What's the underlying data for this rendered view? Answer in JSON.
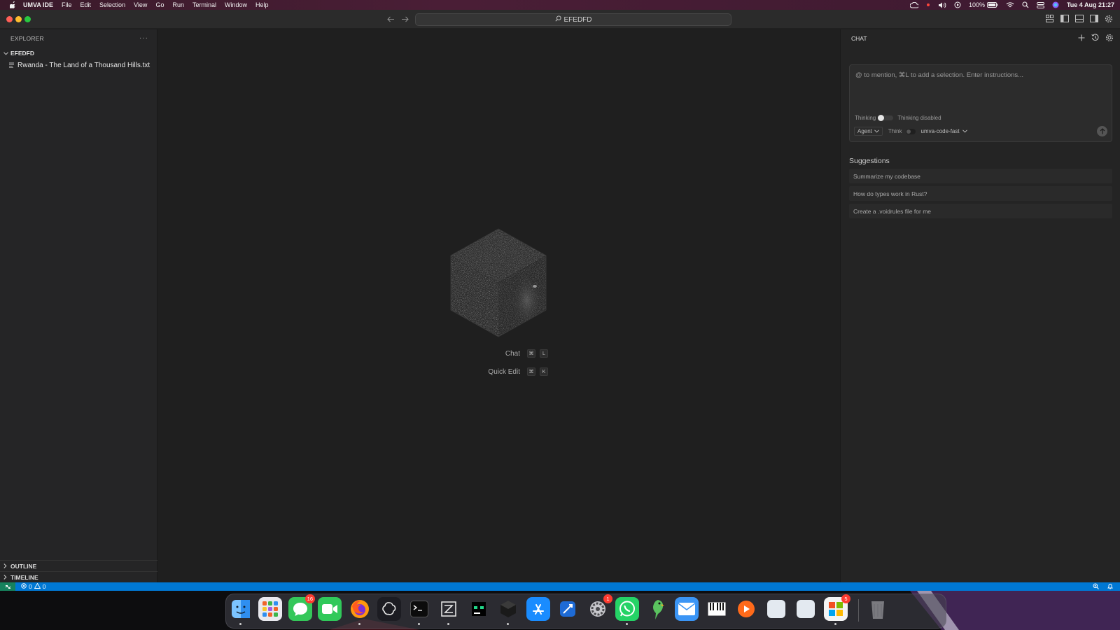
{
  "menubar": {
    "app_name": "UMVA IDE",
    "items": [
      "File",
      "Edit",
      "Selection",
      "View",
      "Go",
      "Run",
      "Terminal",
      "Window",
      "Help"
    ],
    "battery": "100%",
    "datetime": "Tue 4 Aug  21:27"
  },
  "titlebar": {
    "search_text": "EFEDFD"
  },
  "sidebar": {
    "title": "EXPLORER",
    "more": "···",
    "folder": "EFEDFD",
    "file": "Rwanda - The Land of a Thousand Hills.txt",
    "outline": "OUTLINE",
    "timeline": "TIMELINE"
  },
  "editor": {
    "shortcuts": [
      {
        "label": "Chat",
        "keys": [
          "⌘",
          "L"
        ]
      },
      {
        "label": "Quick Edit",
        "keys": [
          "⌘",
          "K"
        ]
      }
    ]
  },
  "chat": {
    "title": "CHAT",
    "placeholder": "@ to mention, ⌘L to add a selection. Enter instructions...",
    "thinking_label": "Thinking",
    "thinking_state": "Thinking disabled",
    "mode": "Agent",
    "think_label": "Think",
    "model": "umva-code-fast",
    "suggestions_title": "Suggestions",
    "suggestions": [
      "Summarize my codebase",
      "How do types work in Rust?",
      "Create a .voidrules file for me"
    ]
  },
  "statusbar": {
    "errors": "0",
    "warnings": "0"
  },
  "dock": {
    "apps": [
      {
        "name": "finder-icon",
        "color": "#2f8ff0"
      },
      {
        "name": "launchpad-icon",
        "color": "#e9e9ee"
      },
      {
        "name": "messages-icon",
        "color": "#34c759",
        "badge": "16"
      },
      {
        "name": "facetime-icon",
        "color": "#30c95a"
      },
      {
        "name": "firefox-icon",
        "color": "#ff7a1a"
      },
      {
        "name": "chatgpt-icon",
        "color": "#1c1c22"
      },
      {
        "name": "terminal-icon",
        "color": "#1a1a1a"
      },
      {
        "name": "zed-icon",
        "color": "#222222"
      },
      {
        "name": "pycharm-icon",
        "color": "#111111"
      },
      {
        "name": "umva-ide-icon",
        "color": "#f2f2f2"
      },
      {
        "name": "app-store-icon",
        "color": "#1a8cff"
      },
      {
        "name": "xcode-icon",
        "color": "#3a8ef0"
      },
      {
        "name": "system-settings-icon",
        "color": "#8e8e93",
        "badge": "1"
      },
      {
        "name": "whatsapp-icon",
        "color": "#25d366"
      },
      {
        "name": "parrot-icon",
        "color": "#43b04a"
      },
      {
        "name": "mail-icon",
        "color": "#3b95f5"
      },
      {
        "name": "piano-icon",
        "color": "#151515"
      },
      {
        "name": "infuse-icon",
        "color": "#ff6a1a"
      },
      {
        "name": "blank-app-icon-1",
        "color": "#dfe6ee"
      },
      {
        "name": "blank-app-icon-2",
        "color": "#dfe6ee"
      },
      {
        "name": "microsoft-icon",
        "color": "#f4f4f4",
        "badge": "5"
      },
      {
        "name": "trash-icon",
        "color": "#5a5a5e"
      }
    ]
  }
}
